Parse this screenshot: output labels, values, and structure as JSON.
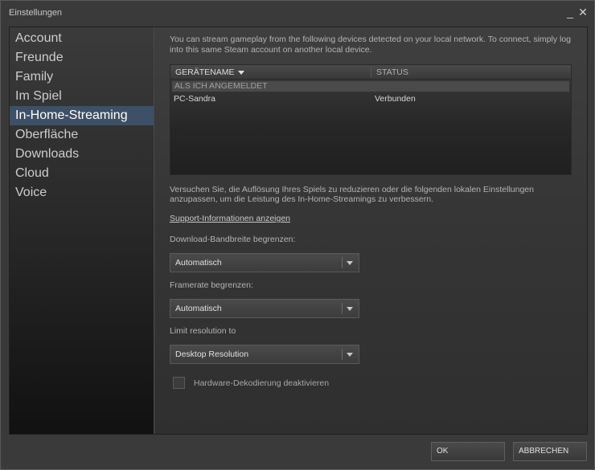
{
  "window": {
    "title": "Einstellungen",
    "minimize_glyph": "_",
    "close_glyph": "✕"
  },
  "sidebar": {
    "items": [
      {
        "label": "Account",
        "active": false
      },
      {
        "label": "Freunde",
        "active": false
      },
      {
        "label": "Family",
        "active": false
      },
      {
        "label": "Im Spiel",
        "active": false
      },
      {
        "label": "In-Home-Streaming",
        "active": true
      },
      {
        "label": "Oberfläche",
        "active": false
      },
      {
        "label": "Downloads",
        "active": false
      },
      {
        "label": "Cloud",
        "active": false
      },
      {
        "label": "Voice",
        "active": false
      }
    ]
  },
  "main": {
    "intro": "You can stream gameplay from the following devices detected on your local network. To connect, simply log into this same Steam account on another local device.",
    "table": {
      "columns": [
        "GERÄTENAME",
        "STATUS"
      ],
      "group": "ALS ICH ANGEMELDET",
      "rows": [
        {
          "name": "PC-Sandra",
          "status": "Verbunden"
        }
      ]
    },
    "hint": "Versuchen Sie, die Auflösung Ihres Spiels zu reduzieren oder die folgenden lokalen Einstellungen anzupassen, um die Leistung des In-Home-Streamings zu verbessern.",
    "support_link": "Support-Informationen anzeigen",
    "bandwidth": {
      "label": "Download-Bandbreite begrenzen:",
      "value": "Automatisch"
    },
    "framerate": {
      "label": "Framerate begrenzen:",
      "value": "Automatisch"
    },
    "resolution": {
      "label": "Limit resolution to",
      "value": "Desktop Resolution"
    },
    "hw_decoding": {
      "label": "Hardware-Dekodierung deaktivieren",
      "checked": false
    }
  },
  "footer": {
    "ok": "OK",
    "cancel": "ABBRECHEN"
  },
  "colors": {
    "active_nav": "#3e5065",
    "window_bg": "#3a3a3a"
  }
}
